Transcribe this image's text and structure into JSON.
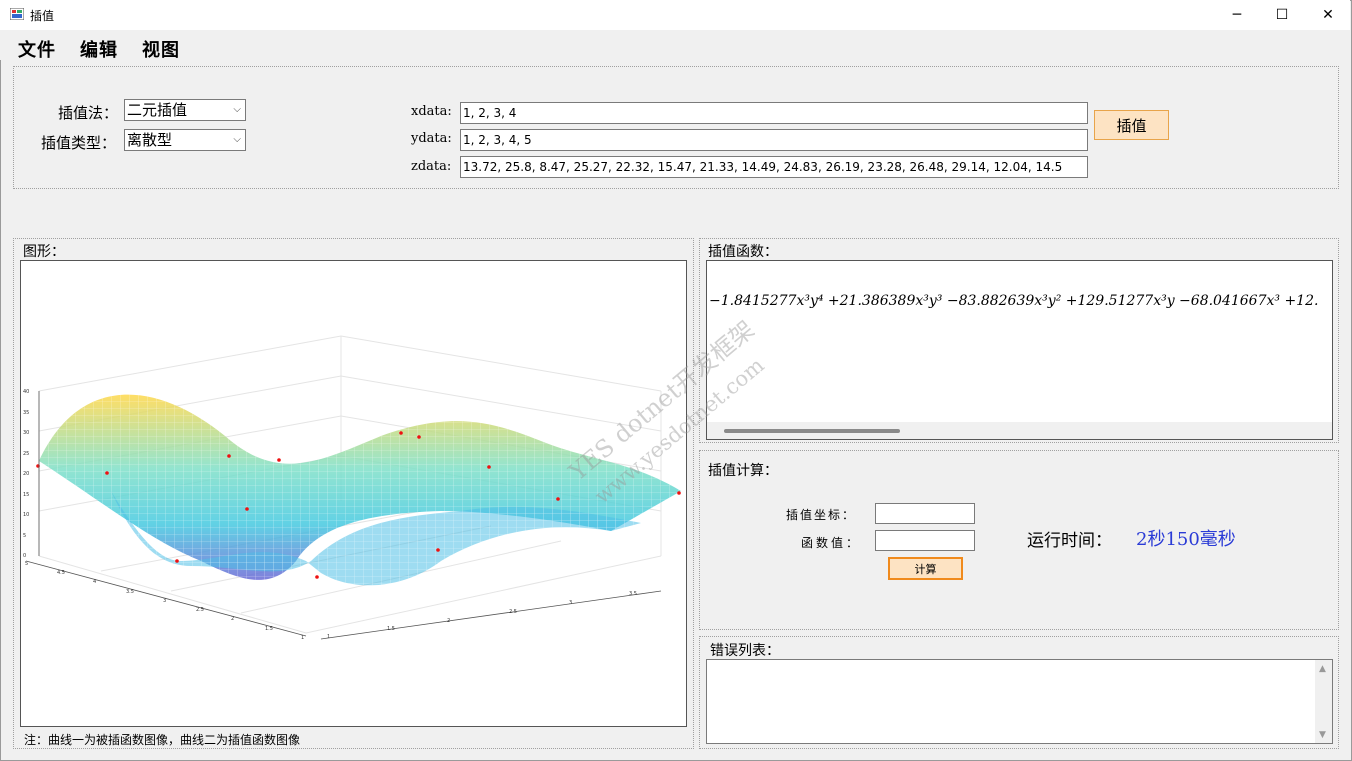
{
  "window": {
    "title": "插值",
    "minimize_glyph": "─",
    "maximize_glyph": "☐",
    "close_glyph": "✕"
  },
  "menu": [
    "文件",
    "编辑",
    "视图"
  ],
  "params": {
    "method_label": "插值法：",
    "method_value": "二元插值",
    "type_label": "插值类型：",
    "type_value": "离散型",
    "xdata_label": "xdata:",
    "xdata_value": "1, 2, 3, 4",
    "ydata_label": "ydata:",
    "ydata_value": "1, 2, 3, 4, 5",
    "zdata_label": "zdata:",
    "zdata_value": "13.72, 25.8, 8.47, 25.27, 22.32, 15.47, 21.33, 14.49, 24.83, 26.19, 23.28, 26.48, 29.14, 12.04, 14.5",
    "interp_button": "插值"
  },
  "graph": {
    "label": "图形：",
    "note": "注：曲线一为被插函数图像，曲线二为插值函数图像",
    "z_ticks": [
      "40",
      "35",
      "30",
      "25",
      "20",
      "15",
      "10",
      "5",
      "0"
    ],
    "y_ticks": [
      "5",
      "4.5",
      "4",
      "3.5",
      "3",
      "2.5",
      "2",
      "1.5",
      "1"
    ],
    "x_ticks": [
      "1",
      "1.5",
      "2",
      "2.5",
      "3",
      "3.5",
      "4"
    ]
  },
  "function_panel": {
    "label": "插值函数：",
    "formula": "−1.8415277x³y⁴ +21.386389x³y³ −83.882639x³y² +129.51277x³y −68.041667x³ +12."
  },
  "calc_panel": {
    "label": "插值计算：",
    "coord_label": "插值坐标：",
    "coord_value": "",
    "value_label": "函数值：",
    "value_value": "",
    "compute_button": "计算",
    "runtime_label": "运行时间：",
    "runtime_value": "2秒150毫秒",
    "runtime_color": "#2a3bd6"
  },
  "error_panel": {
    "label": "错误列表："
  },
  "watermark": {
    "line1": "YES dotnet开发框架",
    "line2": "www.yesdotnet.com"
  }
}
